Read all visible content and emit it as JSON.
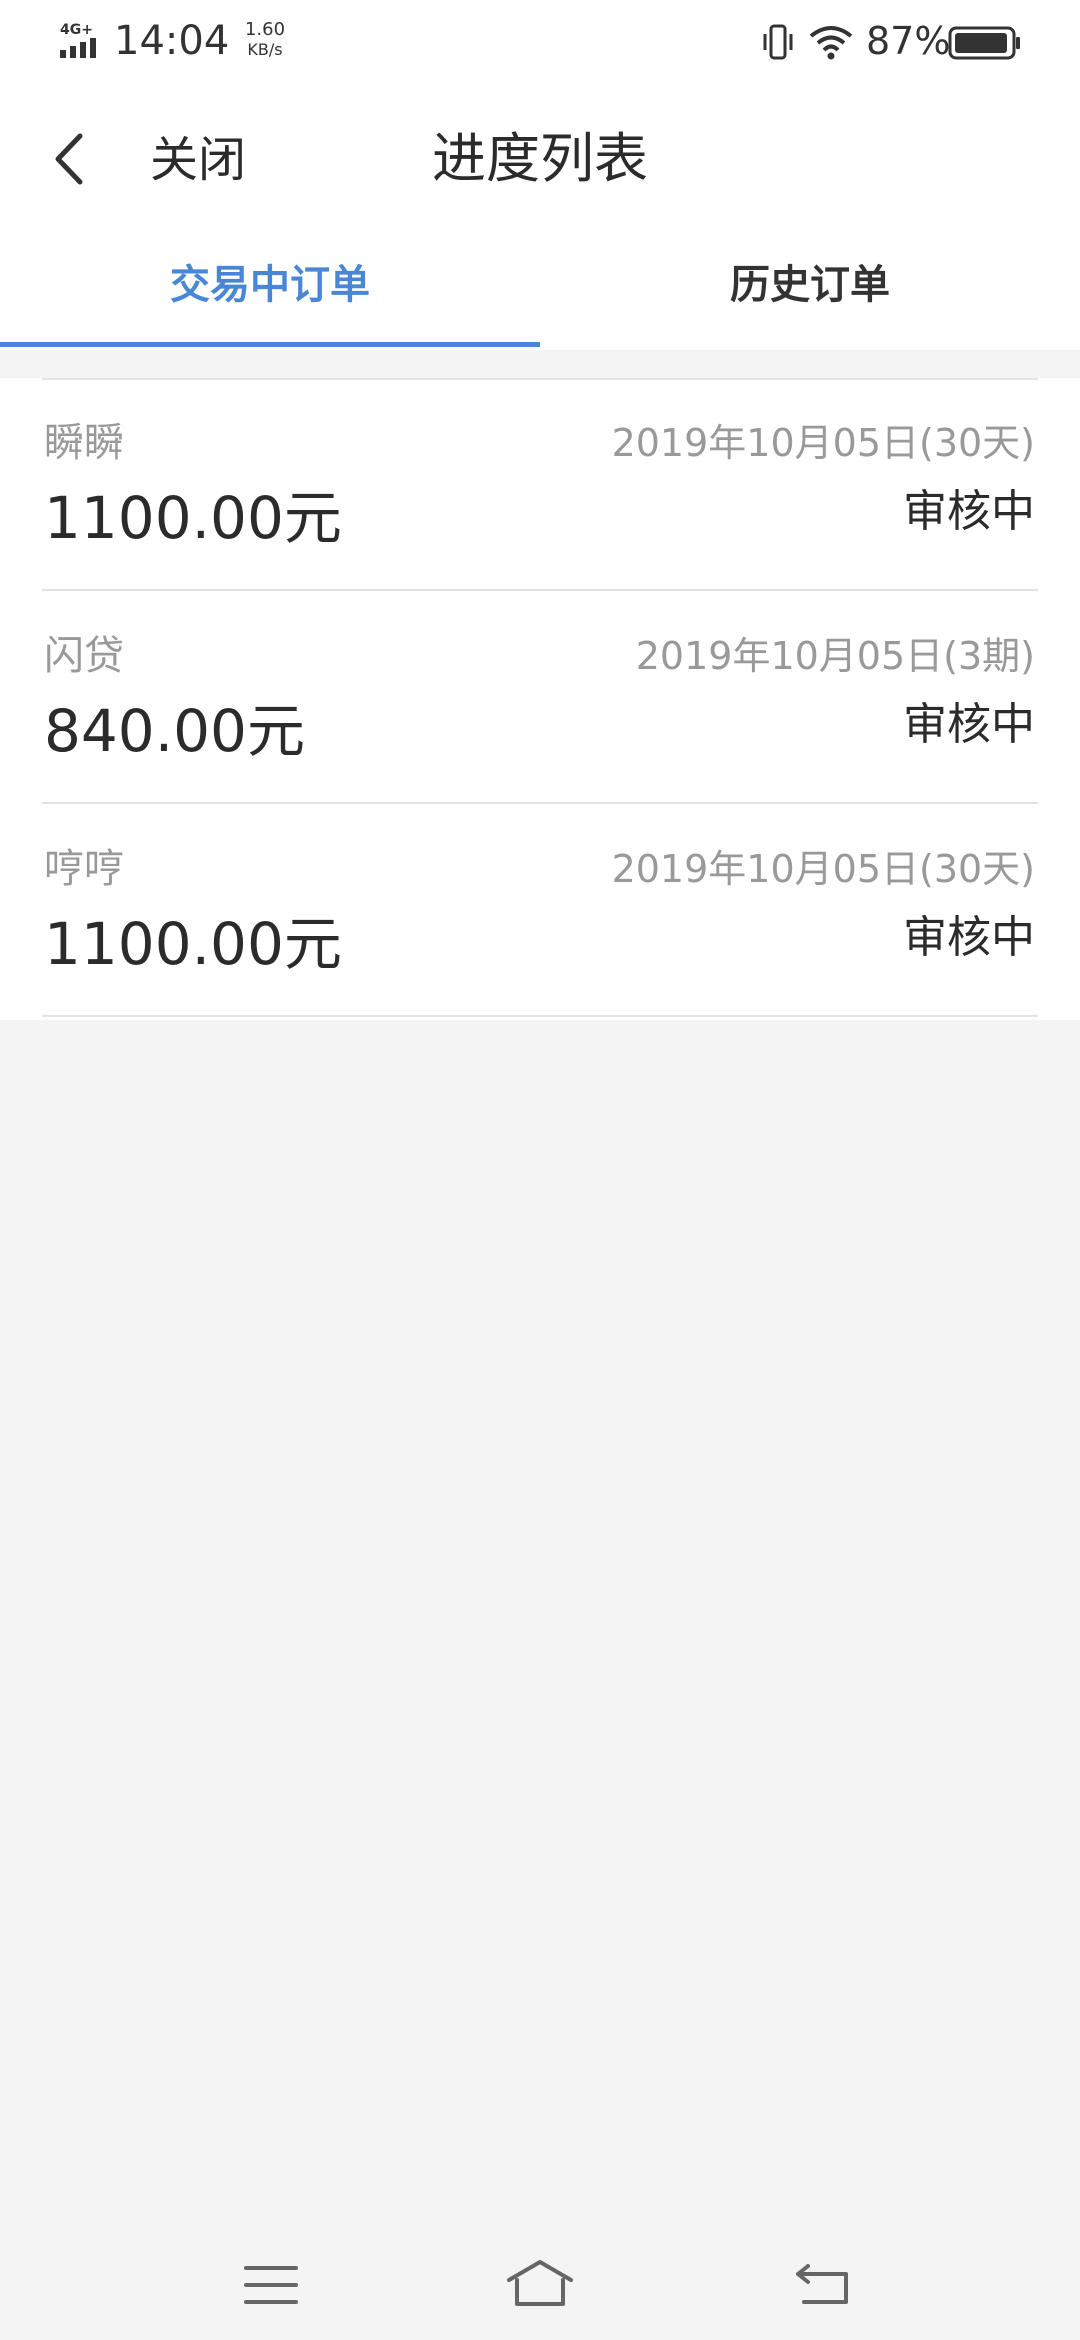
{
  "status_bar": {
    "network": "4G+",
    "time": "14:04",
    "speed_value": "1.60",
    "speed_unit": "KB/s",
    "battery": "87%",
    "icons": [
      "signal-icon",
      "vibrate-icon",
      "wifi-icon",
      "battery-icon"
    ]
  },
  "nav": {
    "close_label": "关闭",
    "title": "进度列表"
  },
  "tabs": [
    {
      "label": "交易中订单",
      "active": true
    },
    {
      "label": "历史订单",
      "active": false
    }
  ],
  "orders": [
    {
      "name": "瞬瞬",
      "date": "2019年10月05日(30天)",
      "amount": "1100.00元",
      "status": "审核中"
    },
    {
      "name": "闪贷",
      "date": "2019年10月05日(3期)",
      "amount": "840.00元",
      "status": "审核中"
    },
    {
      "name": "哼哼",
      "date": "2019年10月05日(30天)",
      "amount": "1100.00元",
      "status": "审核中"
    }
  ],
  "colors": {
    "accent": "#4a86d6",
    "background": "#f4f4f4",
    "card": "#ffffff",
    "secondary_text": "#999999"
  }
}
